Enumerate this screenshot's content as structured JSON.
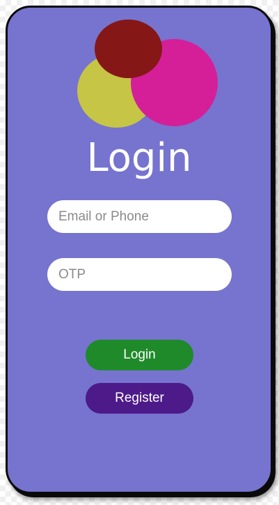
{
  "login_card": {
    "title": "Login",
    "email_field": {
      "placeholder": "Email or Phone",
      "value": ""
    },
    "otp_field": {
      "placeholder": "OTP",
      "value": ""
    },
    "login_button_label": "Login",
    "register_button_label": "Register"
  },
  "colors": {
    "card_background": "#7674cf",
    "logo_yellow": "#c6c545",
    "logo_pink": "#d51f99",
    "logo_dark_red": "#861717",
    "login_button": "#1f8a2a",
    "register_button": "#4d1a8a"
  }
}
